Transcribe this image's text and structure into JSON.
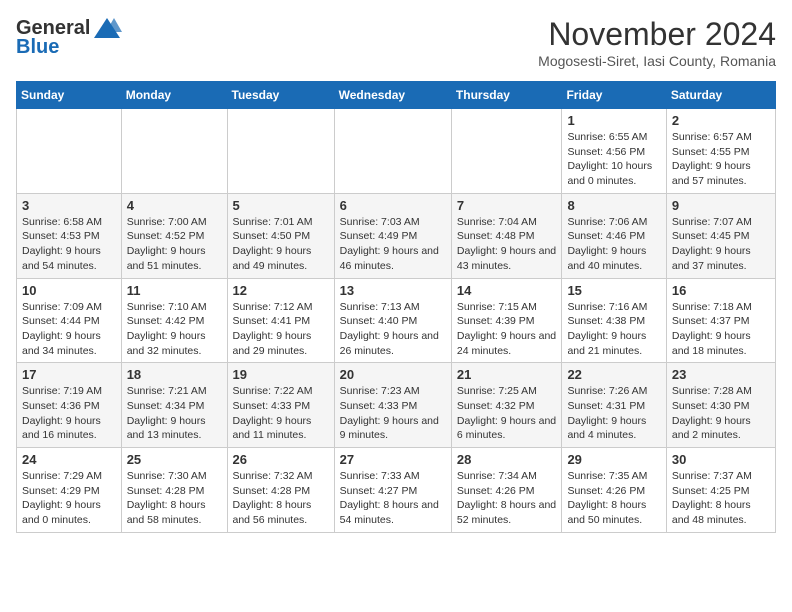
{
  "logo": {
    "general": "General",
    "blue": "Blue"
  },
  "title": "November 2024",
  "subtitle": "Mogosesti-Siret, Iasi County, Romania",
  "days_of_week": [
    "Sunday",
    "Monday",
    "Tuesday",
    "Wednesday",
    "Thursday",
    "Friday",
    "Saturday"
  ],
  "weeks": [
    [
      {
        "day": "",
        "info": ""
      },
      {
        "day": "",
        "info": ""
      },
      {
        "day": "",
        "info": ""
      },
      {
        "day": "",
        "info": ""
      },
      {
        "day": "",
        "info": ""
      },
      {
        "day": "1",
        "info": "Sunrise: 6:55 AM\nSunset: 4:56 PM\nDaylight: 10 hours and 0 minutes."
      },
      {
        "day": "2",
        "info": "Sunrise: 6:57 AM\nSunset: 4:55 PM\nDaylight: 9 hours and 57 minutes."
      }
    ],
    [
      {
        "day": "3",
        "info": "Sunrise: 6:58 AM\nSunset: 4:53 PM\nDaylight: 9 hours and 54 minutes."
      },
      {
        "day": "4",
        "info": "Sunrise: 7:00 AM\nSunset: 4:52 PM\nDaylight: 9 hours and 51 minutes."
      },
      {
        "day": "5",
        "info": "Sunrise: 7:01 AM\nSunset: 4:50 PM\nDaylight: 9 hours and 49 minutes."
      },
      {
        "day": "6",
        "info": "Sunrise: 7:03 AM\nSunset: 4:49 PM\nDaylight: 9 hours and 46 minutes."
      },
      {
        "day": "7",
        "info": "Sunrise: 7:04 AM\nSunset: 4:48 PM\nDaylight: 9 hours and 43 minutes."
      },
      {
        "day": "8",
        "info": "Sunrise: 7:06 AM\nSunset: 4:46 PM\nDaylight: 9 hours and 40 minutes."
      },
      {
        "day": "9",
        "info": "Sunrise: 7:07 AM\nSunset: 4:45 PM\nDaylight: 9 hours and 37 minutes."
      }
    ],
    [
      {
        "day": "10",
        "info": "Sunrise: 7:09 AM\nSunset: 4:44 PM\nDaylight: 9 hours and 34 minutes."
      },
      {
        "day": "11",
        "info": "Sunrise: 7:10 AM\nSunset: 4:42 PM\nDaylight: 9 hours and 32 minutes."
      },
      {
        "day": "12",
        "info": "Sunrise: 7:12 AM\nSunset: 4:41 PM\nDaylight: 9 hours and 29 minutes."
      },
      {
        "day": "13",
        "info": "Sunrise: 7:13 AM\nSunset: 4:40 PM\nDaylight: 9 hours and 26 minutes."
      },
      {
        "day": "14",
        "info": "Sunrise: 7:15 AM\nSunset: 4:39 PM\nDaylight: 9 hours and 24 minutes."
      },
      {
        "day": "15",
        "info": "Sunrise: 7:16 AM\nSunset: 4:38 PM\nDaylight: 9 hours and 21 minutes."
      },
      {
        "day": "16",
        "info": "Sunrise: 7:18 AM\nSunset: 4:37 PM\nDaylight: 9 hours and 18 minutes."
      }
    ],
    [
      {
        "day": "17",
        "info": "Sunrise: 7:19 AM\nSunset: 4:36 PM\nDaylight: 9 hours and 16 minutes."
      },
      {
        "day": "18",
        "info": "Sunrise: 7:21 AM\nSunset: 4:34 PM\nDaylight: 9 hours and 13 minutes."
      },
      {
        "day": "19",
        "info": "Sunrise: 7:22 AM\nSunset: 4:33 PM\nDaylight: 9 hours and 11 minutes."
      },
      {
        "day": "20",
        "info": "Sunrise: 7:23 AM\nSunset: 4:33 PM\nDaylight: 9 hours and 9 minutes."
      },
      {
        "day": "21",
        "info": "Sunrise: 7:25 AM\nSunset: 4:32 PM\nDaylight: 9 hours and 6 minutes."
      },
      {
        "day": "22",
        "info": "Sunrise: 7:26 AM\nSunset: 4:31 PM\nDaylight: 9 hours and 4 minutes."
      },
      {
        "day": "23",
        "info": "Sunrise: 7:28 AM\nSunset: 4:30 PM\nDaylight: 9 hours and 2 minutes."
      }
    ],
    [
      {
        "day": "24",
        "info": "Sunrise: 7:29 AM\nSunset: 4:29 PM\nDaylight: 9 hours and 0 minutes."
      },
      {
        "day": "25",
        "info": "Sunrise: 7:30 AM\nSunset: 4:28 PM\nDaylight: 8 hours and 58 minutes."
      },
      {
        "day": "26",
        "info": "Sunrise: 7:32 AM\nSunset: 4:28 PM\nDaylight: 8 hours and 56 minutes."
      },
      {
        "day": "27",
        "info": "Sunrise: 7:33 AM\nSunset: 4:27 PM\nDaylight: 8 hours and 54 minutes."
      },
      {
        "day": "28",
        "info": "Sunrise: 7:34 AM\nSunset: 4:26 PM\nDaylight: 8 hours and 52 minutes."
      },
      {
        "day": "29",
        "info": "Sunrise: 7:35 AM\nSunset: 4:26 PM\nDaylight: 8 hours and 50 minutes."
      },
      {
        "day": "30",
        "info": "Sunrise: 7:37 AM\nSunset: 4:25 PM\nDaylight: 8 hours and 48 minutes."
      }
    ]
  ]
}
